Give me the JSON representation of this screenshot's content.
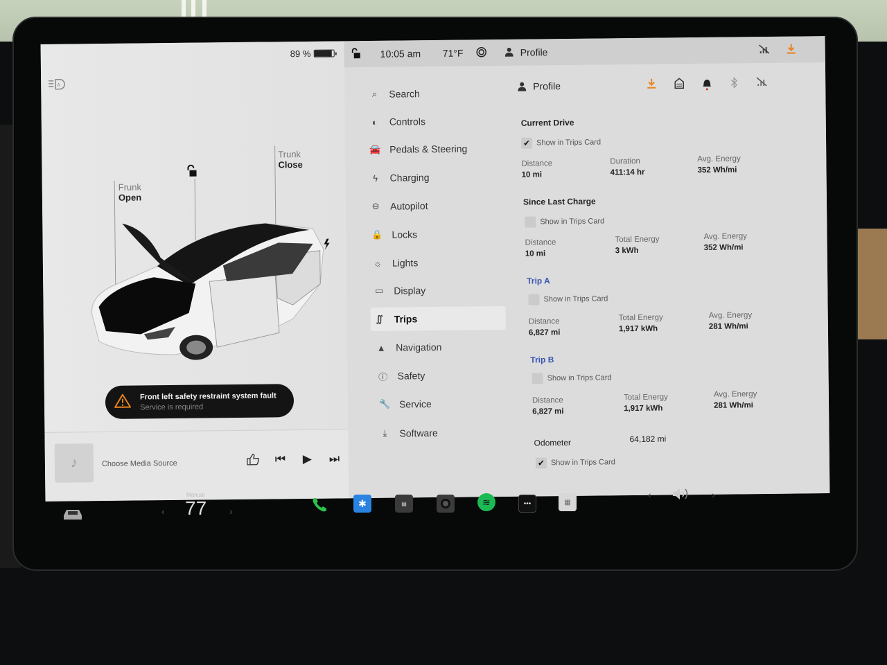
{
  "status_bar": {
    "battery_percent": "89 %",
    "battery_level": 0.89,
    "time": "10:05 am",
    "temperature": "71°F",
    "profile_label": "Profile"
  },
  "car_panel": {
    "frunk": {
      "label": "Frunk",
      "state": "Open"
    },
    "trunk": {
      "label": "Trunk",
      "state": "Close"
    },
    "alert": {
      "title": "Front left safety restraint system fault",
      "subtitle": "Service is required"
    }
  },
  "media": {
    "source_label": "Choose Media Source"
  },
  "nav": {
    "items": [
      {
        "label": "Search",
        "icon": "search-icon"
      },
      {
        "label": "Controls",
        "icon": "toggle-icon"
      },
      {
        "label": "Pedals & Steering",
        "icon": "car-icon"
      },
      {
        "label": "Charging",
        "icon": "bolt-icon"
      },
      {
        "label": "Autopilot",
        "icon": "steering-wheel-icon"
      },
      {
        "label": "Locks",
        "icon": "lock-icon"
      },
      {
        "label": "Lights",
        "icon": "light-icon"
      },
      {
        "label": "Display",
        "icon": "display-icon"
      },
      {
        "label": "Trips",
        "icon": "trips-icon",
        "active": true
      },
      {
        "label": "Navigation",
        "icon": "navigation-icon"
      },
      {
        "label": "Safety",
        "icon": "safety-icon"
      },
      {
        "label": "Service",
        "icon": "wrench-icon"
      },
      {
        "label": "Software",
        "icon": "download-icon"
      }
    ]
  },
  "trips": {
    "profile_label": "Profile",
    "accent_color": "#e8821e",
    "current_drive": {
      "title": "Current Drive",
      "show_in_trips_card": true,
      "checkbox_label": "Show in Trips Card",
      "stats": [
        {
          "label": "Distance",
          "value": "10 mi"
        },
        {
          "label": "Duration",
          "value": "411:14 hr"
        },
        {
          "label": "Avg. Energy",
          "value": "352 Wh/mi"
        }
      ]
    },
    "since_last_charge": {
      "title": "Since Last Charge",
      "show_in_trips_card": false,
      "checkbox_label": "Show in Trips Card",
      "stats": [
        {
          "label": "Distance",
          "value": "10 mi"
        },
        {
          "label": "Total Energy",
          "value": "3 kWh"
        },
        {
          "label": "Avg. Energy",
          "value": "352 Wh/mi"
        }
      ]
    },
    "trip_a": {
      "title": "Trip A",
      "show_in_trips_card": false,
      "checkbox_label": "Show in Trips Card",
      "stats": [
        {
          "label": "Distance",
          "value": "6,827 mi"
        },
        {
          "label": "Total Energy",
          "value": "1,917 kWh"
        },
        {
          "label": "Avg. Energy",
          "value": "281 Wh/mi"
        }
      ]
    },
    "trip_b": {
      "title": "Trip B",
      "show_in_trips_card": false,
      "checkbox_label": "Show in Trips Card",
      "stats": [
        {
          "label": "Distance",
          "value": "6,827 mi"
        },
        {
          "label": "Total Energy",
          "value": "1,917 kWh"
        },
        {
          "label": "Avg. Energy",
          "value": "281 Wh/mi"
        }
      ]
    },
    "odometer": {
      "label": "Odometer",
      "value": "64,182 mi",
      "show_in_trips_card": true,
      "checkbox_label": "Show in Trips Card"
    }
  },
  "taskbar": {
    "climate_mode": "Manual",
    "temperature": "77",
    "apps": [
      "phone",
      "bluetooth",
      "calendar",
      "camera",
      "spotify",
      "more",
      "toybox"
    ]
  }
}
